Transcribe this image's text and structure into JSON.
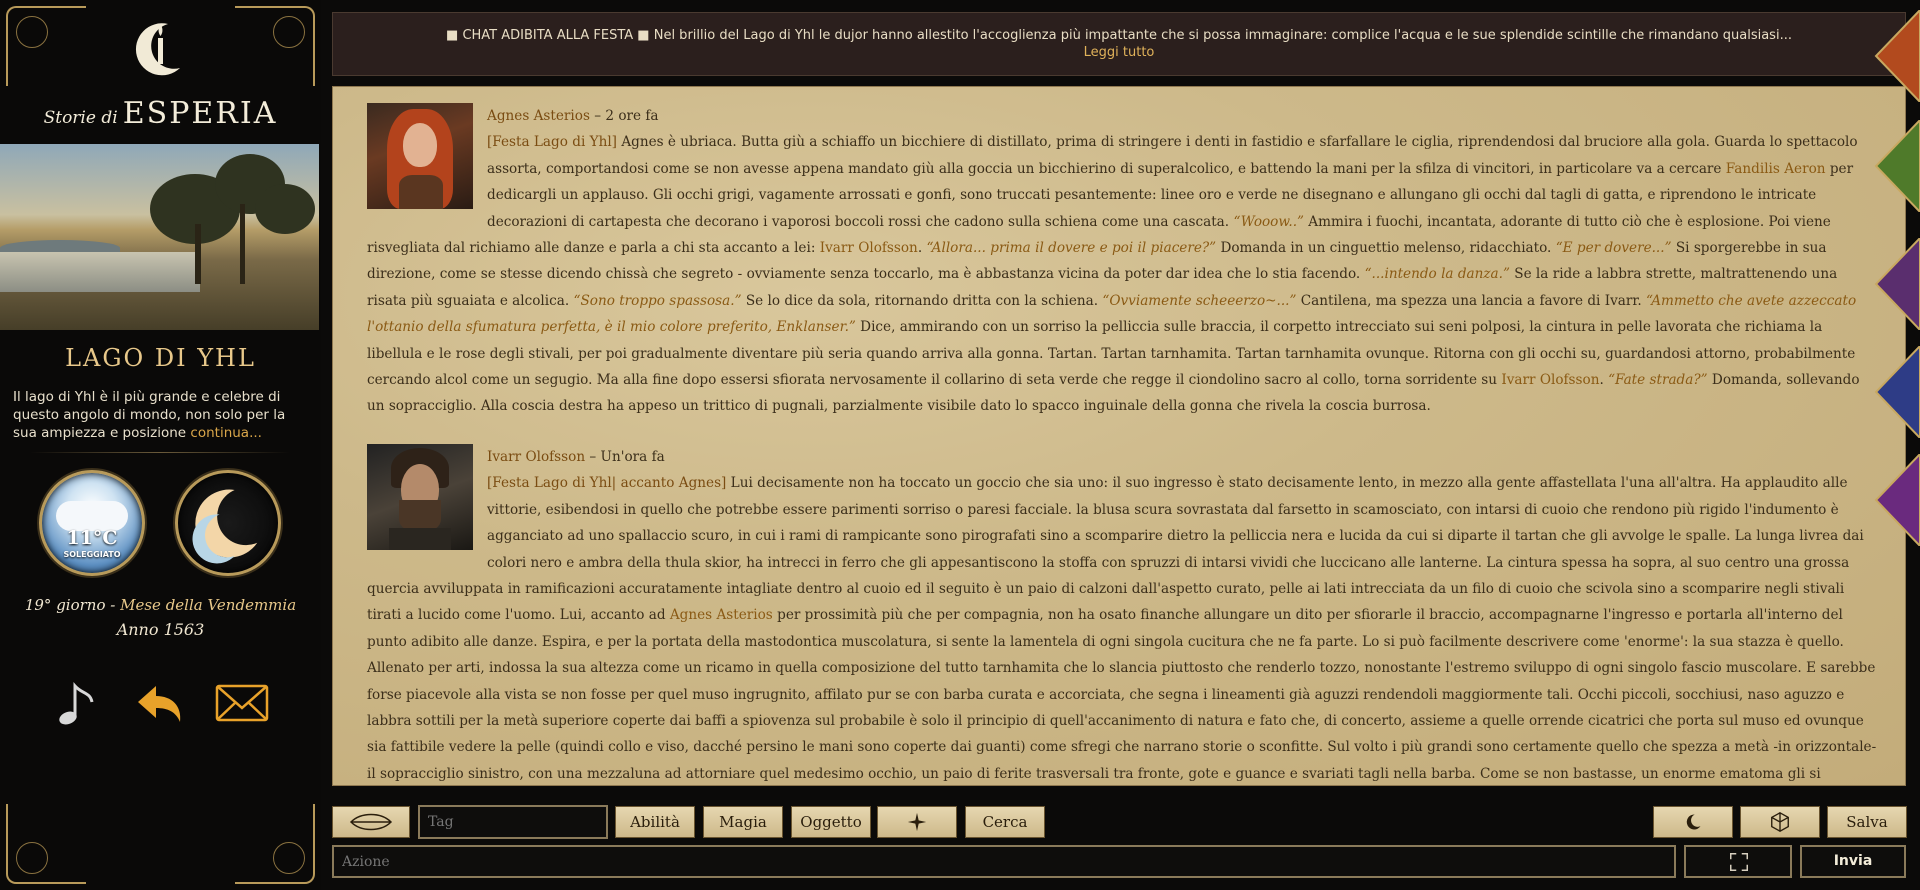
{
  "sidebar": {
    "logo_small": "Storie di",
    "logo_big": "ESPERIA",
    "location_title": "LAGO DI YHL",
    "location_desc": "Il lago di Yhl è il più grande e celebre di questo angolo di mondo, non solo per la sua ampiezza e posizione",
    "location_more": "continua...",
    "weather_temp": "11°C",
    "weather_condition": "SOLEGGIATO",
    "calendar_day": "19° giorno - ",
    "calendar_month": "Mese della Vendemmia",
    "calendar_year": "Anno 1563",
    "icons": [
      "music-note-icon",
      "back-arrow-icon",
      "mail-icon"
    ]
  },
  "news": {
    "text": "■ CHAT ADIBITA ALLA FESTA ■ Nel brillio del Lago di Yhl le dujor hanno allestito l'accoglienza più impattante che si possa immaginare: complice l'acqua e le sue splendide scintille che rimandano qualsiasi...",
    "read_more": "Leggi tutto"
  },
  "posts": [
    {
      "author": "Agnes Asterios",
      "time": " – 2 ore fa",
      "tag": "[Festa Lago di Yhl]",
      "segments": [
        {
          "t": "text",
          "v": " Agnes è ubriaca. Butta giù a schiaffo un bicchiere di distillato, prima di stringere i denti in fastidio e sfarfallare le ciglia, riprendendosi dal bruciore alla gola. Guarda lo spettacolo assorta, comportandosi come se non avesse appena mandato giù alla goccia un bicchierino di superalcolico, e battendo la mani per la sfilza di vincitori, in particolare va a cercare "
        },
        {
          "t": "name",
          "v": "Fandilis Aeron"
        },
        {
          "t": "text",
          "v": " per dedicargli un applauso. Gli occhi grigi, vagamente arrossati e gonfi, sono truccati pesantemente: linee oro e verde ne disegnano e allungano gli occhi dal tagli di gatta, e riprendono le intricate decorazioni di cartapesta che decorano i vaporosi boccoli rossi che cadono sulla schiena come una cascata. "
        },
        {
          "t": "speech",
          "v": "“Wooow..”"
        },
        {
          "t": "text",
          "v": " Ammira i fuochi, incantata, adorante di tutto ciò che è esplosione. Poi viene risvegliata dal richiamo alle danze e parla a chi sta accanto a lei: "
        },
        {
          "t": "name",
          "v": "Ivarr Olofsson"
        },
        {
          "t": "text",
          "v": ". "
        },
        {
          "t": "speech",
          "v": "“Allora... prima il dovere e poi il piacere?”"
        },
        {
          "t": "text",
          "v": " Domanda in un cinguettio melenso, ridacchiato. "
        },
        {
          "t": "speech",
          "v": "“E per dovere...”"
        },
        {
          "t": "text",
          "v": " Si sporgerebbe in sua direzione, come se stesse dicendo chissà che segreto - ovviamente senza toccarlo, ma è abbastanza vicina da poter dar idea che lo stia facendo. "
        },
        {
          "t": "speech",
          "v": "“...intendo la danza.”"
        },
        {
          "t": "text",
          "v": " Se la ride a labbra strette, maltrattenendo una risata più sguaiata e alcolica. "
        },
        {
          "t": "speech",
          "v": "“Sono troppo spassosa.”"
        },
        {
          "t": "text",
          "v": " Se lo dice da sola, ritornando dritta con la schiena. "
        },
        {
          "t": "speech",
          "v": "“Ovviamente scheeerzo~...”"
        },
        {
          "t": "text",
          "v": " Cantilena, ma spezza una lancia a favore di Ivarr. "
        },
        {
          "t": "speech",
          "v": "“Ammetto che avete azzeccato l'ottanio della sfumatura perfetta, è il mio colore preferito, Enklanser.”"
        },
        {
          "t": "text",
          "v": " Dice, ammirando con un sorriso la pelliccia sulle braccia, il corpetto intrecciato sui seni polposi, la cintura in pelle lavorata che richiama la libellula e le rose degli stivali, per poi gradualmente diventare più seria quando arriva alla gonna. Tartan. Tartan tarnhamita. Tartan tarnhamita ovunque. Ritorna con gli occhi su, guardandosi attorno, probabilmente cercando alcol come un segugio. Ma alla fine dopo essersi sfiorata nervosamente il collarino di seta verde che regge il ciondolino sacro al collo, torna sorridente su "
        },
        {
          "t": "name",
          "v": "Ivarr Olofsson"
        },
        {
          "t": "text",
          "v": ". "
        },
        {
          "t": "speech",
          "v": "“Fate strada?”"
        },
        {
          "t": "text",
          "v": " Domanda, sollevando un sopracciglio. Alla coscia destra ha appeso un trittico di pugnali, parzialmente visibile dato lo spacco inguinale della gonna che rivela la coscia burrosa."
        }
      ]
    },
    {
      "author": "Ivarr Olofsson",
      "time": " – Un'ora fa",
      "tag": "[Festa Lago di Yhl| accanto Agnes]",
      "segments": [
        {
          "t": "text",
          "v": " Lui decisamente non ha toccato un goccio che sia uno: il suo ingresso è stato decisamente lento, in mezzo alla gente affastellata l'una all'altra. Ha applaudito alle vittorie, esibendosi in quello che potrebbe essere parimenti sorriso o paresi facciale. la blusa scura sovrastata dal farsetto in scamosciato, con intarsi di cuoio che rendono più rigido l'indumento è agganciato ad uno spallaccio scuro, in cui i rami di rampicante sono pirografati sino a scomparire dietro la pelliccia nera e lucida da cui si diparte il tartan che gli avvolge le spalle. La lunga livrea dai colori nero e ambra della thula skior, ha intrecci in ferro che gli appesantiscono la stoffa con spruzzi di intarsi vividi che luccicano alle lanterne. La cintura spessa ha sopra, al suo centro una grossa quercia avviluppata in ramificazioni accuratamente intagliate dentro al cuoio ed il seguito è un paio di calzoni dall'aspetto curato, pelle ai lati intrecciata da un filo di cuoio che scivola sino a scomparire negli stivali tirati a lucido come l'uomo. Lui, accanto ad "
        },
        {
          "t": "name",
          "v": "Agnes Asterios"
        },
        {
          "t": "text",
          "v": " per prossimità più che per compagnia, non ha osato finanche allungare un dito per sfiorarle il braccio, accompagnarne l'ingresso e portarla all'interno del punto adibito alle danze. Espira, e per la portata della mastodontica muscolatura, si sente la lamentela di ogni singola cucitura che ne fa parte. Lo si può facilmente descrivere come 'enorme': la sua stazza è quello. Allenato per arti, indossa la sua altezza come un ricamo in quella composizione del tutto tarnhamita che lo slancia piuttosto che renderlo tozzo, nonostante l'estremo sviluppo di ogni singolo fascio muscolare. E sarebbe forse piacevole alla vista se non fosse per quel muso ingrugnito, affilato pur se con barba curata e accorciata, che segna i lineamenti già aguzzi rendendoli maggiormente tali. Occhi piccoli, socchiusi, naso aguzzo e labbra sottili per la metà superiore coperte dai baffi a spiovenza sul probabile è solo il principio di quell'accanimento di natura e fato che, di concerto, assieme a quelle orrende cicatrici che porta sul muso ed ovunque sia fattibile vedere la pelle (quindi collo e viso, dacché persino le mani sono coperte dai guanti) come sfregi che narrano storie o sconfitte. Sul volto i più grandi sono certamente quello che spezza a metà -in orizzontale- il sopracciglio sinistro, con una mezzaluna ad attorniare quel medesimo occhio, un paio di ferite trasversali tra fronte, gote e guance e svariati tagli nella barba. Come se non bastasse, un enorme ematoma gli si estende sulla guancia sinistra mentre a destra un taglio fresco e rosso brillante gli spezza il labbro inferiore, proseguendo verso la base del mento."
        }
      ]
    }
  ],
  "toolbar": {
    "tag_placeholder": "Tag",
    "abilita": "Abilità",
    "magia": "Magia",
    "oggetto": "Oggetto",
    "cerca": "Cerca",
    "salva": "Salva",
    "action_placeholder": "Azione",
    "send": "Invia"
  },
  "nav_tabs": [
    {
      "color": "#b24a1e"
    },
    {
      "color": "#4f7a2a"
    },
    {
      "color": "#5a2e6e"
    },
    {
      "color": "#2e3c86"
    },
    {
      "color": "#6a2a7e"
    },
    {
      "color": "#c25a12"
    }
  ]
}
